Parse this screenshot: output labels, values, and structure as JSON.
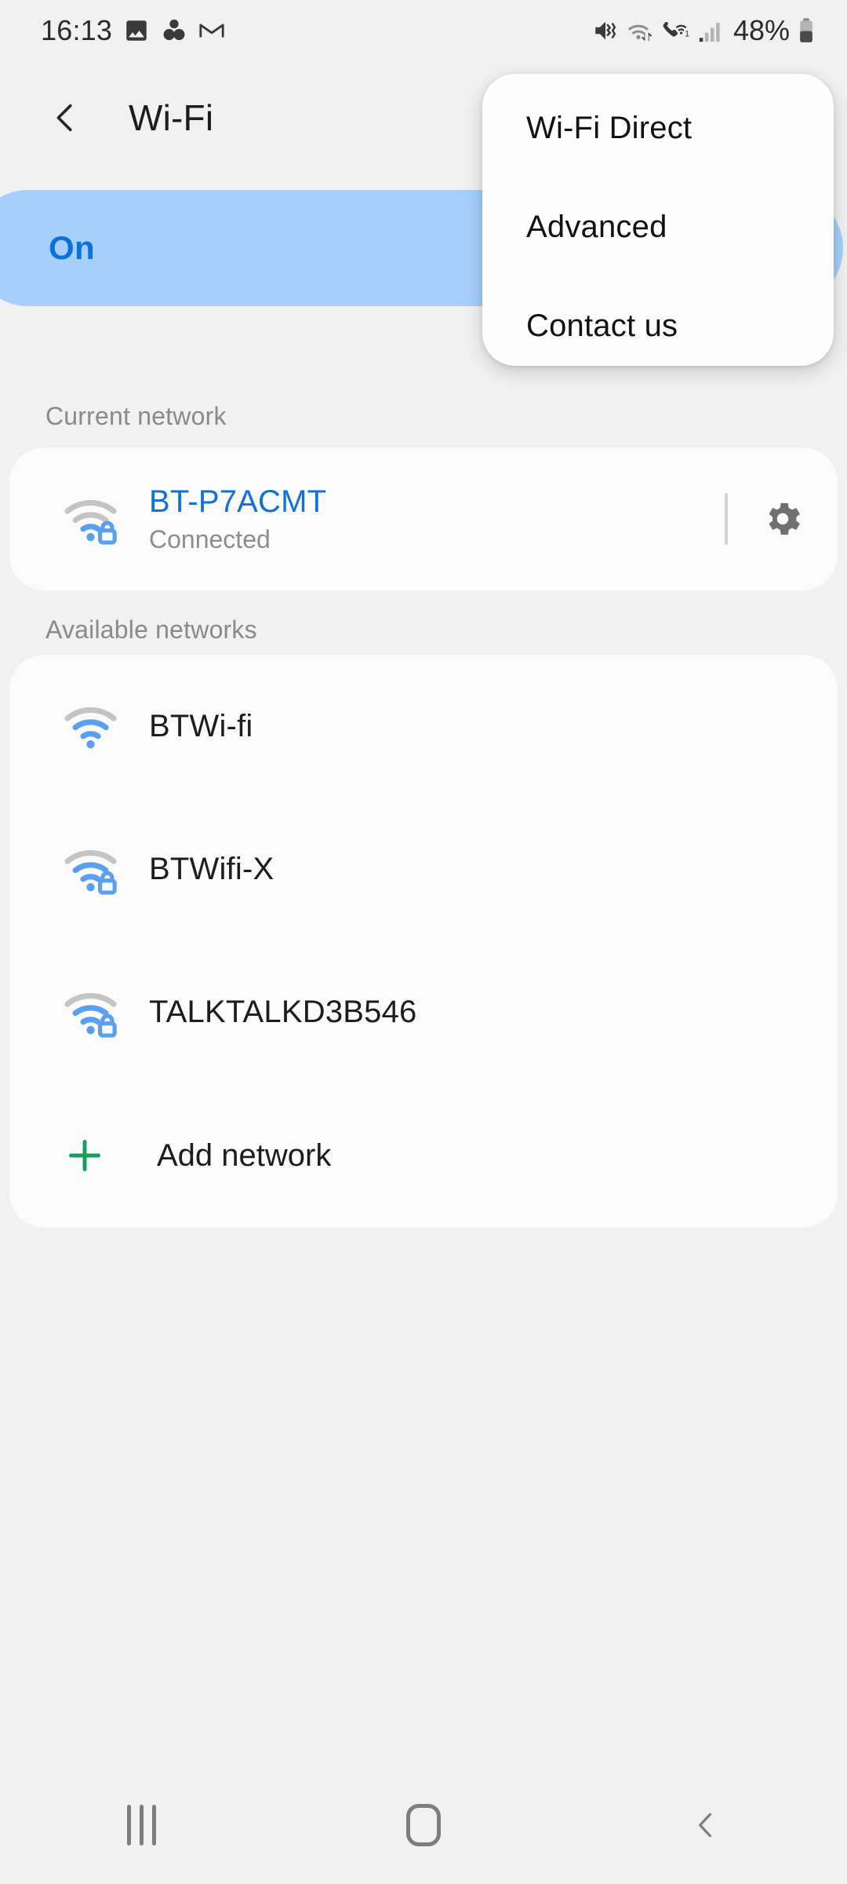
{
  "status_bar": {
    "time": "16:13",
    "left_icons": [
      "image-icon",
      "google-photos-icon",
      "gmail-icon"
    ],
    "right_icons": [
      "mute-vibrate-icon",
      "wifi-data-icon",
      "wifi-calling-icon",
      "cellular-signal-icon"
    ],
    "battery_percent": "48%",
    "battery_icon": "battery-icon"
  },
  "app_bar": {
    "back_icon": "back-chevron-icon",
    "title": "Wi-Fi"
  },
  "wifi_toggle": {
    "label": "On",
    "state": "on",
    "pill_color": "#a7cffc",
    "label_color": "#0b72dd"
  },
  "overflow_menu": {
    "visible": true,
    "items": [
      {
        "label": "Wi-Fi Direct"
      },
      {
        "label": "Advanced"
      },
      {
        "label": "Contact us"
      }
    ]
  },
  "current_network_section": {
    "header": "Current network",
    "network": {
      "name": "BT-P7ACMT",
      "status": "Connected",
      "name_color": "#1271d6",
      "icon": "wifi-locked-icon",
      "signal_bars": 1,
      "secured": true,
      "settings_icon": "gear-icon"
    }
  },
  "available_networks_section": {
    "header": "Available networks",
    "networks": [
      {
        "name": "BTWi-fi",
        "icon": "wifi-open-icon",
        "signal_bars": 2,
        "secured": false
      },
      {
        "name": "BTWifi-X",
        "icon": "wifi-locked-icon",
        "signal_bars": 2,
        "secured": true
      },
      {
        "name": "TALKTALKD3B546",
        "icon": "wifi-locked-icon",
        "signal_bars": 2,
        "secured": true
      }
    ],
    "add_network": {
      "label": "Add network",
      "icon": "plus-icon",
      "icon_color": "#14a05a"
    }
  },
  "navigation_bar": {
    "recents_icon": "recents-icon",
    "home_icon": "home-icon",
    "back_icon": "back-chevron-icon"
  },
  "theme": {
    "background": "#f1f1f1",
    "card_background": "#fbfbfb",
    "primary_text": "#1d1d1d",
    "secondary_text": "#8a8a8a",
    "accent_blue": "#1271d6",
    "wifi_icon_blue": "#5aa0f0",
    "wifi_icon_gray": "#c4c4c4"
  }
}
